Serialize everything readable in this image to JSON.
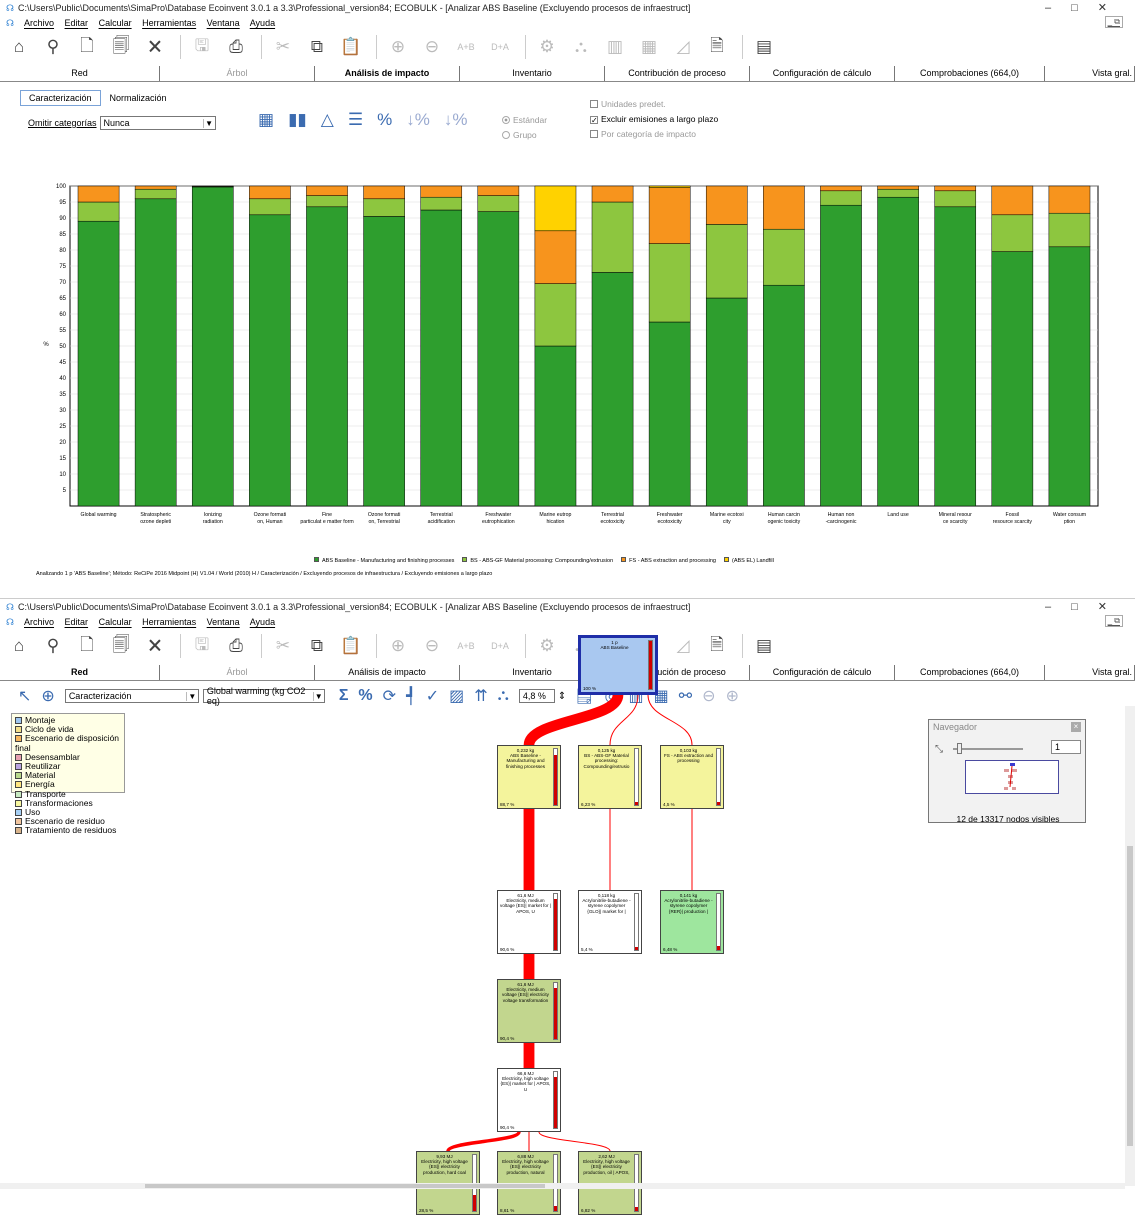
{
  "window1": {
    "title": "C:\\Users\\Public\\Documents\\SimaPro\\Database Ecoinvent 3.0.1 a 3.3\\Professional_version84; ECOBULK - [Analizar ABS Baseline (Excluyendo procesos de infraestruct]",
    "menu": [
      "Archivo",
      "Editar",
      "Calcular",
      "Herramientas",
      "Ventana",
      "Ayuda"
    ],
    "tabs": [
      {
        "label": "Red",
        "state": "normal"
      },
      {
        "label": "Árbol",
        "state": "disabled"
      },
      {
        "label": "Análisis de impacto",
        "state": "active"
      },
      {
        "label": "Inventario",
        "state": "normal"
      },
      {
        "label": "Contribución de proceso",
        "state": "normal"
      },
      {
        "label": "Configuración de cálculo",
        "state": "normal"
      },
      {
        "label": "Comprobaciones (664,0)",
        "state": "normal"
      },
      {
        "label": "Vista gral.",
        "state": "normal"
      }
    ],
    "subtabs": [
      "Caracterización",
      "Normalización"
    ],
    "omit_label": "Omitir categorías",
    "omit_value": "Nunca",
    "radio_standard": "Estándar",
    "radio_group": "Grupo",
    "check_units": "Unidades predet.",
    "check_exclude": "Excluir emisiones a largo plazo",
    "check_category": "Por categoría de impacto",
    "chart_legend": [
      "ABS Baseline - Manufacturing and finishing processes",
      "BS - ABS-GF Material processing: Compounding/extrusion",
      "FS - ABS extraction and processing",
      "(ABS EL) Landfill"
    ],
    "footnote": "Analizando 1 p 'ABS Baseline'; Método: ReCiPe 2016 Midpoint (H) V1.04 / World (2010) H / Caracterización / Excluyendo procesos de infraestructura / Excluyendo emisiones a largo plazo"
  },
  "chart_data": {
    "type": "bar",
    "stacked": true,
    "ylabel": "%",
    "ylim": [
      0,
      100
    ],
    "yticks": [
      5,
      10,
      15,
      20,
      25,
      30,
      35,
      40,
      45,
      50,
      55,
      60,
      65,
      70,
      75,
      80,
      85,
      90,
      95,
      100
    ],
    "grid": true,
    "legend_position": "bottom",
    "categories": [
      "Global warming",
      "Stratospheric ozone depleti",
      "Ionizing radiation",
      "Ozone formati on, Human",
      "Fine particulat e matter form",
      "Ozone formati on, Terrestrial",
      "Terrestrial acidification",
      "Freshwater eutrophication",
      "Marine eutrop hication",
      "Terrestrial ecotoxicity",
      "Freshwater ecotoxicity",
      "Marine ecotoxi city",
      "Human carcin ogenic toxicity",
      "Human non -carcinogenic",
      "Land use",
      "Mineral resour ce scarcity",
      "Fossil resource scarcity",
      "Water consum ption"
    ],
    "series": [
      {
        "name": "ABS Baseline - Manufacturing and finishing processes",
        "color": "#2e9e2e",
        "values": [
          89,
          96,
          99.7,
          91,
          93.5,
          90.5,
          92.5,
          92,
          50,
          73,
          57.5,
          65,
          69,
          94,
          96.5,
          93.5,
          79.5,
          81
        ]
      },
      {
        "name": "BS - ABS-GF Material processing: Compounding/extrusion",
        "color": "#8dc63f",
        "values": [
          6,
          3,
          0.2,
          5,
          3.5,
          5.5,
          4,
          5,
          19.5,
          22,
          24.5,
          23,
          17.5,
          4.5,
          2.5,
          5,
          11.5,
          10.5
        ]
      },
      {
        "name": "FS - ABS extraction and processing",
        "color": "#f7941d",
        "values": [
          5,
          1,
          0.1,
          4,
          3,
          4,
          3.5,
          3,
          16.5,
          5,
          17.5,
          12,
          13.5,
          1.5,
          1,
          1.5,
          9,
          8.5
        ]
      },
      {
        "name": "(ABS EL) Landfill",
        "color": "#ffd200",
        "values": [
          0,
          0,
          0,
          0,
          0,
          0,
          0,
          0,
          14,
          0,
          0.5,
          0,
          0,
          0,
          0,
          0,
          0,
          0
        ]
      }
    ]
  },
  "window2": {
    "title": "C:\\Users\\Public\\Documents\\SimaPro\\Database Ecoinvent 3.0.1 a 3.3\\Professional_version84; ECOBULK - [Analizar ABS Baseline (Excluyendo procesos de infraestruct]",
    "menu": [
      "Archivo",
      "Editar",
      "Calcular",
      "Herramientas",
      "Ventana",
      "Ayuda"
    ],
    "tabs": [
      {
        "label": "Red",
        "state": "active"
      },
      {
        "label": "Árbol",
        "state": "disabled"
      },
      {
        "label": "Análisis de impacto",
        "state": "normal"
      },
      {
        "label": "Inventario",
        "state": "normal"
      },
      {
        "label": "Contribución de proceso",
        "state": "normal"
      },
      {
        "label": "Configuración de cálculo",
        "state": "normal"
      },
      {
        "label": "Comprobaciones (664,0)",
        "state": "normal"
      },
      {
        "label": "Vista gral.",
        "state": "normal"
      }
    ],
    "mode_select": "Caracterización",
    "indicator_select": "Global warming (kg CO2 eq)",
    "cutoff": "4,8 %",
    "legend_items": [
      {
        "label": "Montaje",
        "color": "#9ec6f0"
      },
      {
        "label": "Ciclo de vida",
        "color": "#f4e08a"
      },
      {
        "label": "Escenario de disposición final",
        "color": "#f6b65c"
      },
      {
        "label": "Desensamblar",
        "color": "#e7a0b0"
      },
      {
        "label": "Reutilizar",
        "color": "#b8a4e0"
      },
      {
        "label": "Material",
        "color": "#b9d98c"
      },
      {
        "label": "Energía",
        "color": "#ffe680"
      },
      {
        "label": "Transporte",
        "color": "#c7eac2"
      },
      {
        "label": "Transformaciones",
        "color": "#f7f7a0"
      },
      {
        "label": "Uso",
        "color": "#a7d0f5"
      },
      {
        "label": "Escenario de residuo",
        "color": "#f2c6a0"
      },
      {
        "label": "Tratamiento de residuos",
        "color": "#d9b48c"
      }
    ],
    "navigator": {
      "title": "Navegador",
      "zoom": "1",
      "status": "12 de 13317 nodos visibles"
    },
    "nodes": [
      {
        "id": "root",
        "amount": "1 p",
        "name": "ABS Baseline",
        "pct": "100 %",
        "fill": 1.0
      },
      {
        "id": "manuf",
        "amount": "0,232 kg",
        "name": "ABS Baseline - Manufacturing and finishing processes",
        "pct": "88,7 %",
        "fill": 0.887
      },
      {
        "id": "bs",
        "amount": "0,125 kg",
        "name": "BS - ABS-GF Material processing: Compounding/extrusio",
        "pct": "6,23 %",
        "fill": 0.062
      },
      {
        "id": "fs",
        "amount": "0,103 kg",
        "name": "FS - ABS extraction and processing",
        "pct": "4,5 %",
        "fill": 0.045
      },
      {
        "id": "elec_mv_mkt",
        "amount": "61,6 MJ",
        "name": "Electricity, medium voltage {ES}| market for | APOS, U",
        "pct": "90,6 %",
        "fill": 0.906
      },
      {
        "id": "abs_mkt",
        "amount": "0,118 kg",
        "name": "Acrylonitrile-butadiene -styrene copolymer {GLO}| market for |",
        "pct": "5,4 %",
        "fill": 0.054
      },
      {
        "id": "abs_prod",
        "amount": "0,141 kg",
        "name": "Acrylonitrile-butadiene -styrene copolymer {RER}| production |",
        "pct": "6,48 %",
        "fill": 0.065
      },
      {
        "id": "elec_mv_trans",
        "amount": "61,6 MJ",
        "name": "Electricity, medium voltage {ES}| electricity voltage transformation",
        "pct": "90,4 %",
        "fill": 0.904
      },
      {
        "id": "elec_hv_mkt",
        "amount": "66,6 MJ",
        "name": "Electricity, high voltage {ES}| market for | APOS, U",
        "pct": "90,4 %",
        "fill": 0.904
      },
      {
        "id": "hv_coal",
        "amount": "9,93 MJ",
        "name": "Electricity, high voltage {ES}| electricity production, hard coal",
        "pct": "28,5 %",
        "fill": 0.285
      },
      {
        "id": "hv_gas",
        "amount": "6,88 MJ",
        "name": "Electricity, high voltage {ES}| electricity production, natural",
        "pct": "8,61 %",
        "fill": 0.086
      },
      {
        "id": "hv_oil",
        "amount": "2,62 MJ",
        "name": "Electricity, high voltage {ES}| electricity production, oil | APOS,",
        "pct": "6,82 %",
        "fill": 0.068
      }
    ]
  }
}
